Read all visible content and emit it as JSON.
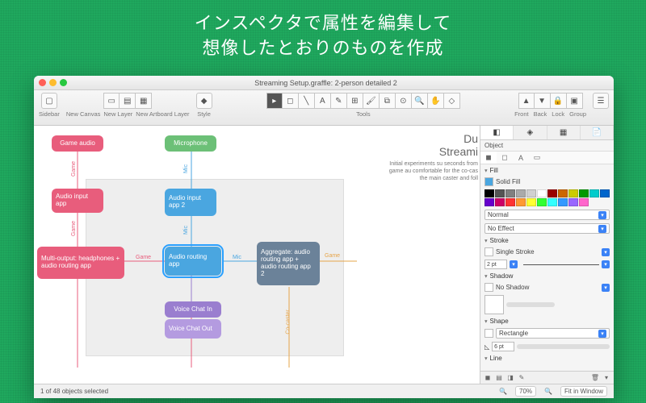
{
  "hero": {
    "line1": "インスペクタで属性を編集して",
    "line2": "想像したとおりのものを作成"
  },
  "window_title": "Streaming Setup.graffle: 2-person detailed 2",
  "toolbar": {
    "sidebar": "Sidebar",
    "new_canvas": "New Canvas",
    "new_layer": "New Layer",
    "new_artboard": "New Artboard Layer",
    "style": "Style",
    "tools": "Tools",
    "front": "Front",
    "back": "Back",
    "lock": "Lock",
    "group": "Group"
  },
  "doc": {
    "title_l1": "Du",
    "title_l2": "Streami",
    "body": "Initial experiments su seconds from game au comfortable for the co-cas the main caster and foll"
  },
  "nodes": {
    "game_audio": "Game audio",
    "microphone": "Microphone",
    "audio_input": "Audio input app",
    "audio_input_2": "Audio input app 2",
    "multi_output": "Multi-output: headphones + audio routing app",
    "audio_routing": "Audio routing app",
    "aggregate": "Aggregate: audio routing app + audio routing app 2",
    "voice_chat_in": "Voice Chat In",
    "voice_chat_out": "Voice Chat Out"
  },
  "edge_labels": {
    "game": "Game",
    "mic": "Mic",
    "co_caster": "Co-caster"
  },
  "status": {
    "selection": "1 of 48 objects selected",
    "zoom": "70%",
    "fit": "Fit in Window"
  },
  "inspector": {
    "header": "Object",
    "fill": {
      "title": "Fill",
      "type": "Solid Fill",
      "blend": "Normal",
      "effect": "No Effect"
    },
    "stroke": {
      "title": "Stroke",
      "type": "Single Stroke",
      "width": "2 pt"
    },
    "shadow": {
      "title": "Shadow",
      "type": "No Shadow"
    },
    "shape": {
      "title": "Shape",
      "type": "Rectangle",
      "radius": "6 pt"
    },
    "line": {
      "title": "Line"
    },
    "palette_colors": [
      "#000000",
      "#555555",
      "#808080",
      "#aaaaaa",
      "#d0d0d0",
      "#ffffff",
      "#990000",
      "#cc6600",
      "#cccc00",
      "#009900",
      "#00cccc",
      "#0066cc",
      "#6600cc",
      "#cc0066",
      "#ff3333",
      "#ff9933",
      "#ffff33",
      "#33ff33",
      "#33ffff",
      "#3399ff",
      "#9966ff",
      "#ff66cc"
    ]
  }
}
